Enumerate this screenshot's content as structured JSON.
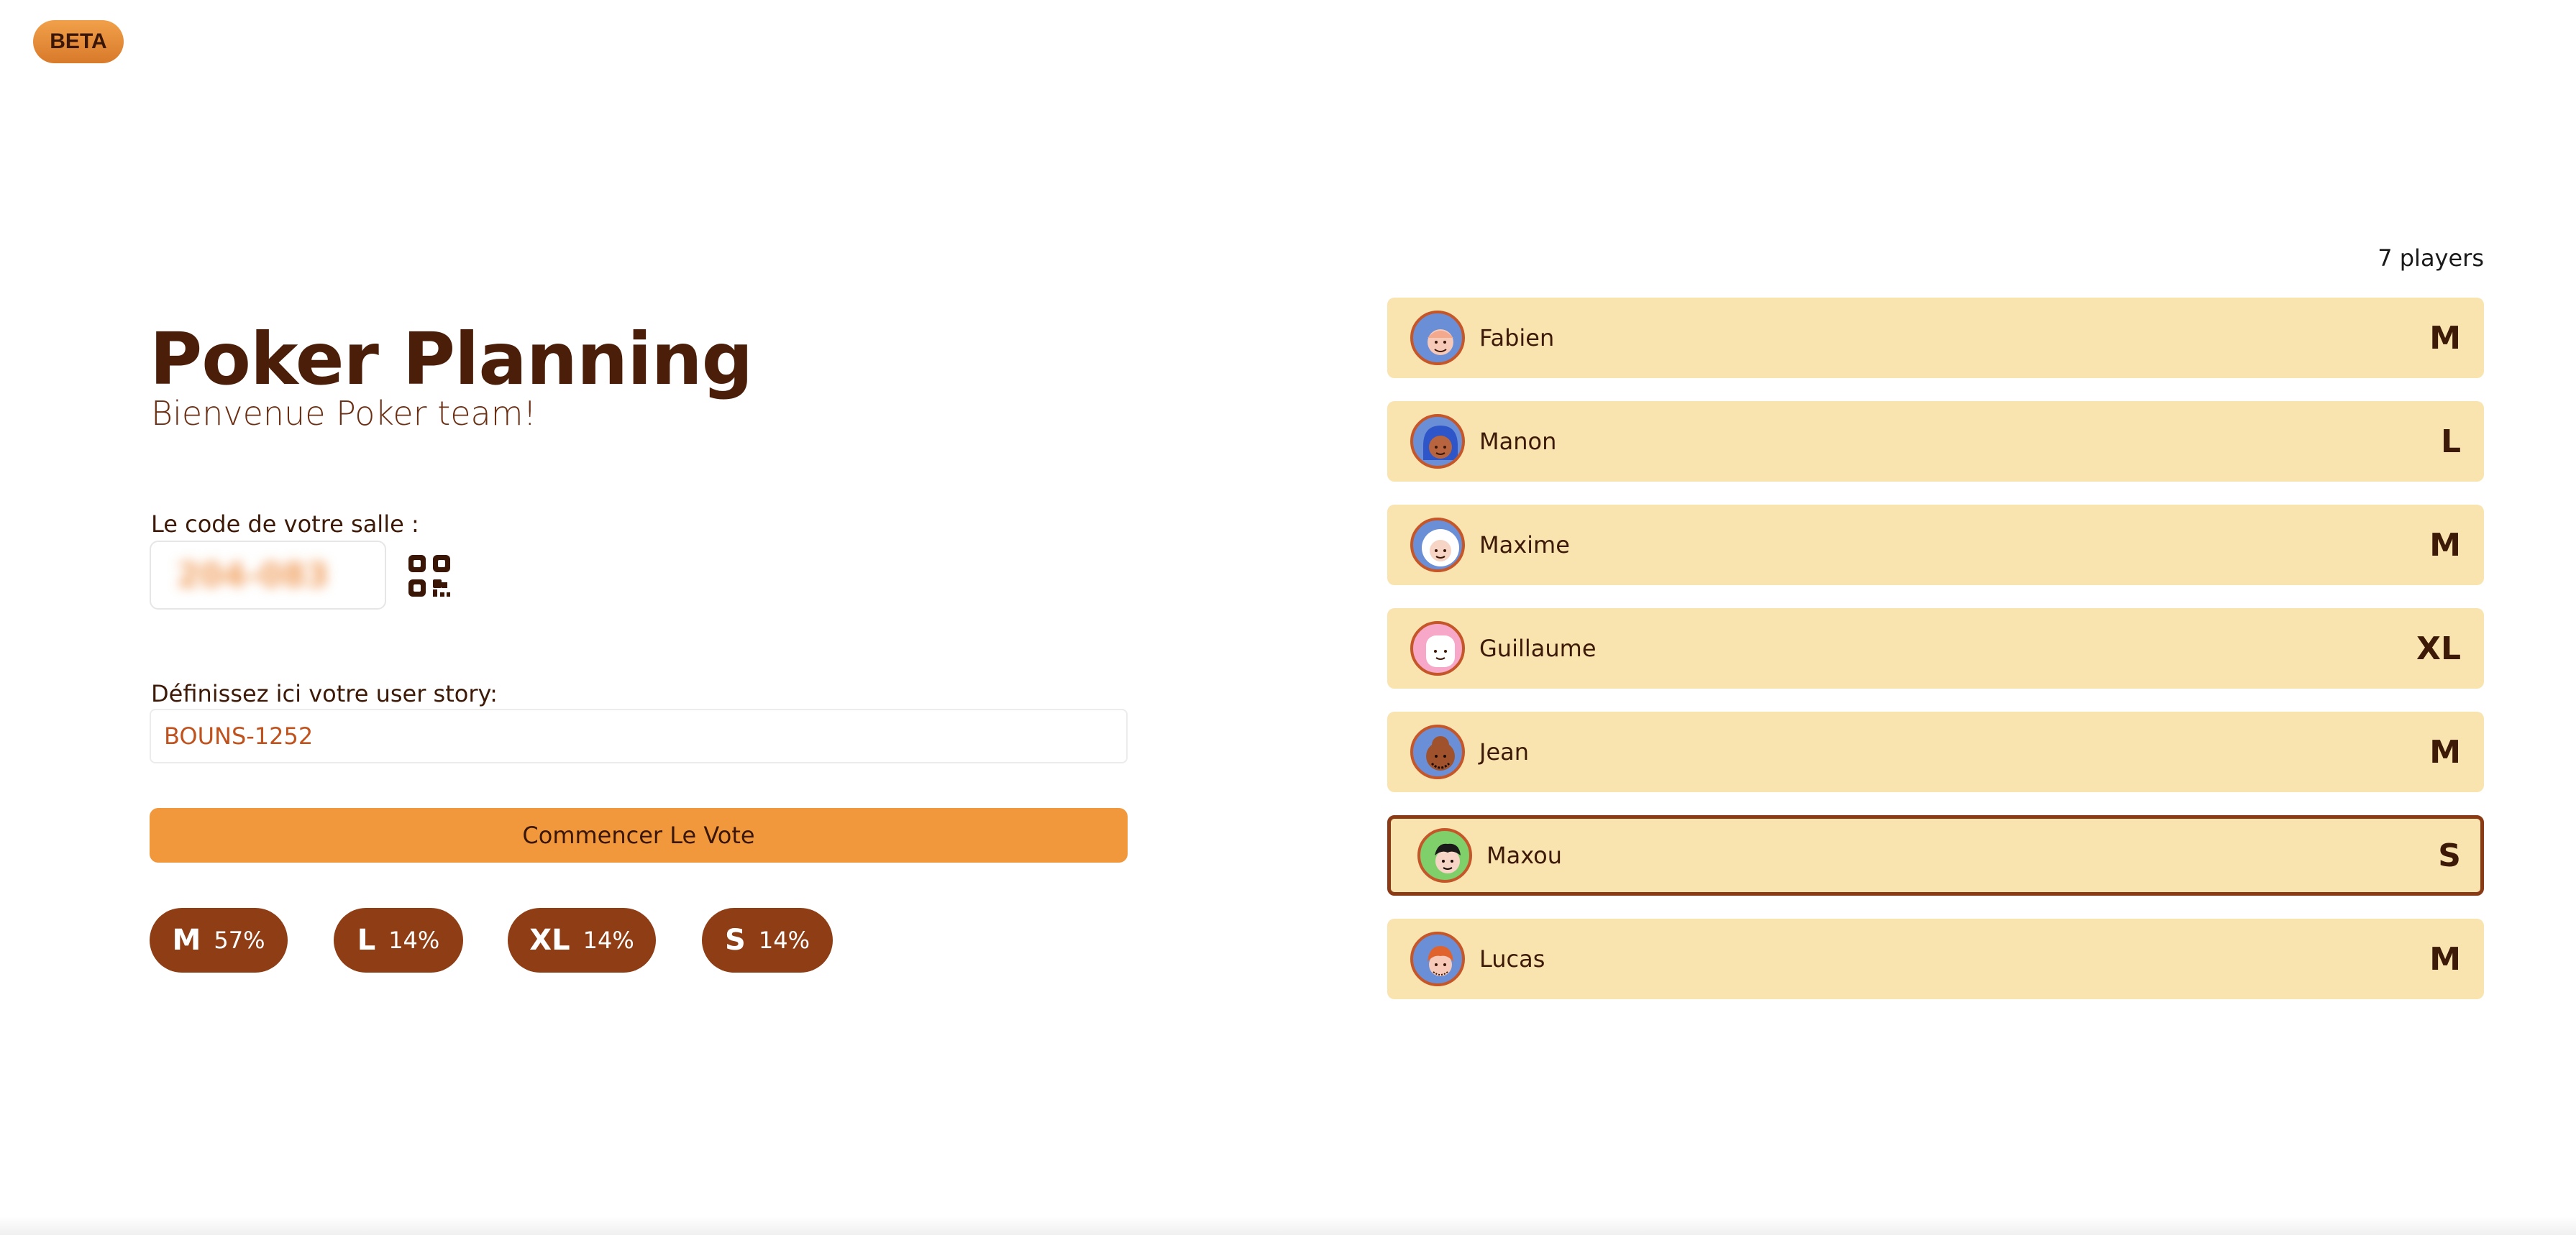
{
  "badge": {
    "label": "BETA"
  },
  "header": {
    "title": "Poker Planning",
    "subtitle": "Bienvenue Poker team!"
  },
  "room": {
    "label": "Le code de votre salle :",
    "code": "204-083",
    "qr_icon": "qr-code-icon"
  },
  "story": {
    "label": "Définissez ici votre user story:",
    "value": "BOUNS-1252"
  },
  "start_button": {
    "label": "Commencer Le Vote"
  },
  "stats": [
    {
      "value": "M",
      "percent": "57%"
    },
    {
      "value": "L",
      "percent": "14%"
    },
    {
      "value": "XL",
      "percent": "14%"
    },
    {
      "value": "S",
      "percent": "14%"
    }
  ],
  "players": {
    "count_label": "7 players",
    "list": [
      {
        "name": "Fabien",
        "vote": "M",
        "avatar_bg": "#6b8fd6"
      },
      {
        "name": "Manon",
        "vote": "L",
        "avatar_bg": "#6b8fd6"
      },
      {
        "name": "Maxime",
        "vote": "M",
        "avatar_bg": "#6b8fd6"
      },
      {
        "name": "Guillaume",
        "vote": "XL",
        "avatar_bg": "#f7a8c8"
      },
      {
        "name": "Jean",
        "vote": "M",
        "avatar_bg": "#6b8fd6"
      },
      {
        "name": "Maxou",
        "vote": "S",
        "avatar_bg": "#7fcf6a",
        "current": true
      },
      {
        "name": "Lucas",
        "vote": "M",
        "avatar_bg": "#6b8fd6"
      }
    ]
  },
  "colors": {
    "accent": "#f1983c",
    "brown": "#8e3d14",
    "card": "#f9e3ae",
    "title": "#4a1e08"
  }
}
